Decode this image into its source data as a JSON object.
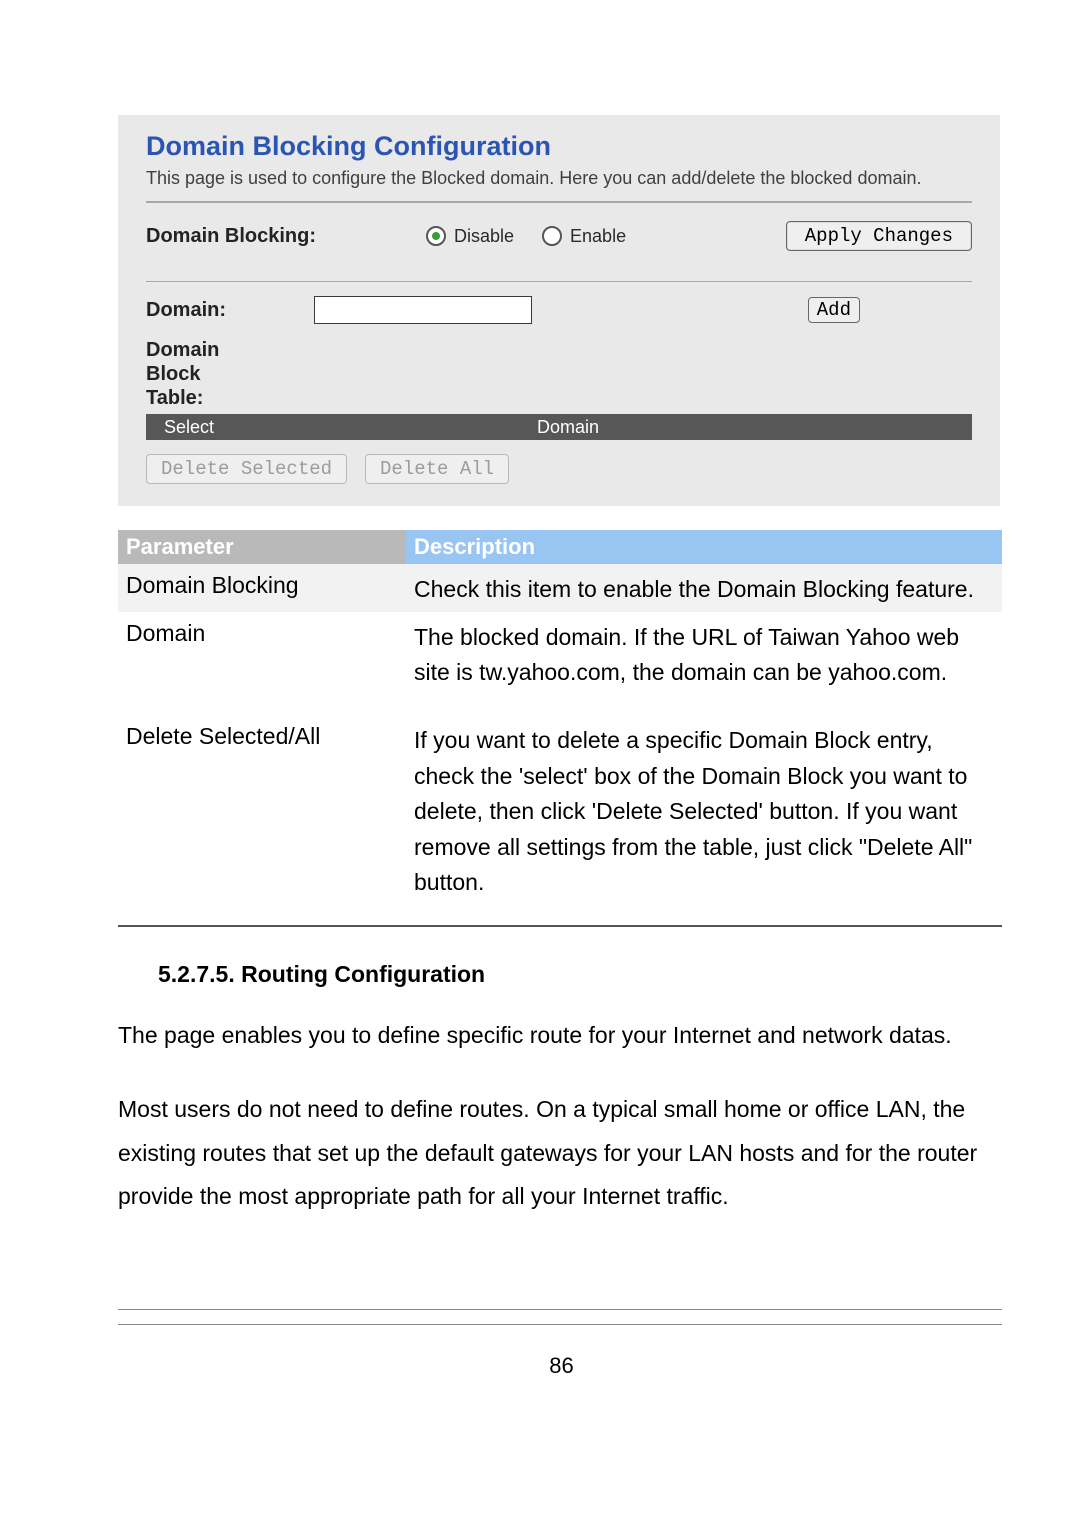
{
  "panel": {
    "title": "Domain Blocking Configuration",
    "subtitle": "This page is used to configure the Blocked domain. Here you can add/delete the blocked domain.",
    "blocking_label": "Domain Blocking:",
    "disable_label": "Disable",
    "enable_label": "Enable",
    "apply_btn": "Apply Changes",
    "domain_label": "Domain:",
    "add_btn": "Add",
    "table_label_1": "Domain",
    "table_label_2": "Block",
    "table_label_3": "Table:",
    "header_select": "Select",
    "header_domain": "Domain",
    "delete_selected_btn": "Delete Selected",
    "delete_all_btn": "Delete All"
  },
  "params": {
    "header_param": "Parameter",
    "header_desc": "Description",
    "rows": [
      {
        "name": "Domain Blocking",
        "desc": "Check this item to enable the Domain Blocking feature."
      },
      {
        "name": "Domain",
        "desc": "The blocked domain. If the URL of Taiwan Yahoo web site is tw.yahoo.com, the domain can be yahoo.com."
      },
      {
        "name": "Delete Selected/All",
        "desc": "If you want to delete a specific Domain Block entry, check the 'select' box of the Domain Block you want to delete, then click 'Delete Selected' button. If you want remove all settings from the table, just click \"Delete All\" button."
      }
    ]
  },
  "section": {
    "number": "5.2.7.5. Routing Configuration",
    "para1": "The page enables you to define specific route for your Internet and network datas.",
    "para2": "Most users do not need to define routes. On a typical small home or office LAN, the existing routes that set up the default gateways for your LAN hosts and for the router provide the most appropriate path for all your Internet traffic."
  },
  "page_number": "86"
}
